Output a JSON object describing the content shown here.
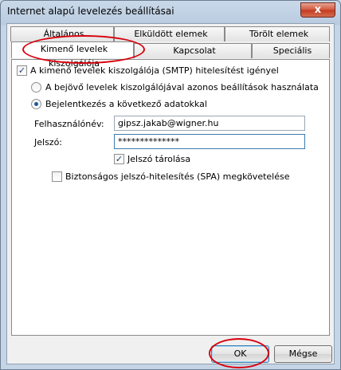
{
  "window": {
    "title": "Internet alapú levelezés beállításai",
    "close_glyph": "x"
  },
  "tabs": {
    "altalanos": "Általános",
    "elkuldott": "Elküldött elemek",
    "torolt": "Törölt elemek",
    "kimeno": "Kimenő levelek kiszolgálója",
    "kapcsolat": "Kapcsolat",
    "specialis": "Speciális"
  },
  "smtp_auth": {
    "label": "A kimenő levelek kiszolgálója (SMTP) hitelesítést igényel",
    "checked": true
  },
  "radio_same": {
    "label": "A bejövő levelek kiszolgálójával azonos beállítások használata",
    "selected": false
  },
  "radio_login": {
    "label": "Bejelentkezés a következő adatokkal",
    "selected": true
  },
  "username": {
    "label": "Felhasználónév:",
    "value": "gipsz.jakab@wigner.hu"
  },
  "password": {
    "label": "Jelszó:",
    "value": "**************"
  },
  "remember_password": {
    "label": "Jelszó tárolása",
    "checked": true
  },
  "spa": {
    "label": "Biztonságos jelszó-hitelesítés (SPA) megkövetelése",
    "checked": false
  },
  "buttons": {
    "ok": "OK",
    "cancel": "Mégse"
  },
  "annotation_color": "#d8000c"
}
